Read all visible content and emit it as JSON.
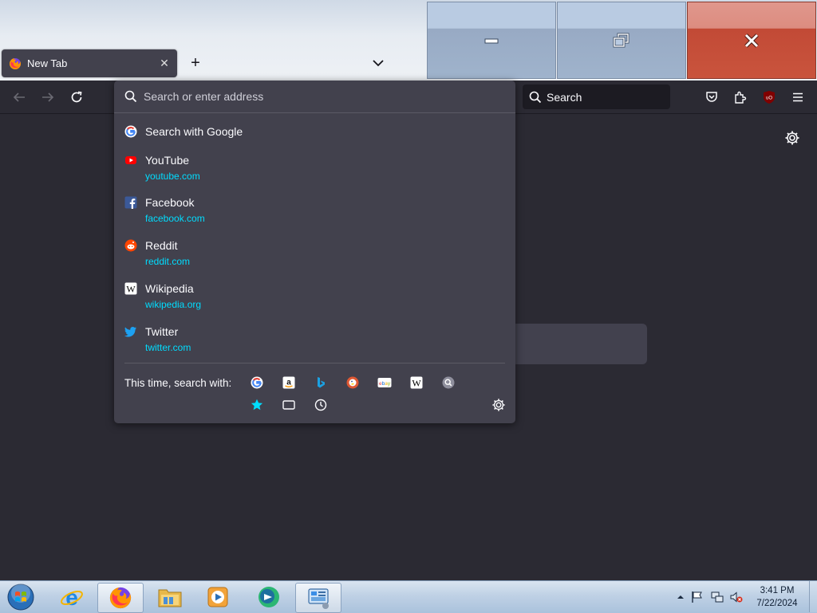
{
  "browser": {
    "tab": {
      "title": "New Tab",
      "close_label": "✕"
    },
    "new_tab_label": "+",
    "window_controls": {
      "minimize": "minimize",
      "maximize": "restore",
      "close": "close"
    }
  },
  "toolbar": {
    "search_placeholder": "Search",
    "extension_badge": "uO"
  },
  "urlbar": {
    "placeholder": "Search or enter address",
    "results": [
      {
        "title": "Search with Google",
        "url": "",
        "icon": "google-icon"
      },
      {
        "title": "YouTube",
        "url": "youtube.com",
        "icon": "youtube-icon"
      },
      {
        "title": "Facebook",
        "url": "facebook.com",
        "icon": "facebook-icon"
      },
      {
        "title": "Reddit",
        "url": "reddit.com",
        "icon": "reddit-icon"
      },
      {
        "title": "Wikipedia",
        "url": "wikipedia.org",
        "icon": "wikipedia-icon"
      },
      {
        "title": "Twitter",
        "url": "twitter.com",
        "icon": "twitter-icon"
      }
    ],
    "oneoff_label": "This time, search with:",
    "engines": [
      "Google",
      "Amazon",
      "Bing",
      "DuckDuckGo",
      "eBay",
      "Wikipedia",
      "Search"
    ],
    "modes": [
      "Bookmarks",
      "Tabs",
      "History"
    ]
  },
  "taskbar": {
    "apps": [
      "Start",
      "Internet Explorer",
      "Firefox",
      "Windows Explorer",
      "Windows Media Player",
      "Windows Live",
      "Control Panel"
    ],
    "clock": {
      "time": "3:41 PM",
      "date": "7/22/2024"
    }
  },
  "colors": {
    "panel_bg": "#42414d",
    "toolbar_bg": "#2b2a33",
    "url_color": "#00ddff",
    "close_button": "#c24a36"
  }
}
